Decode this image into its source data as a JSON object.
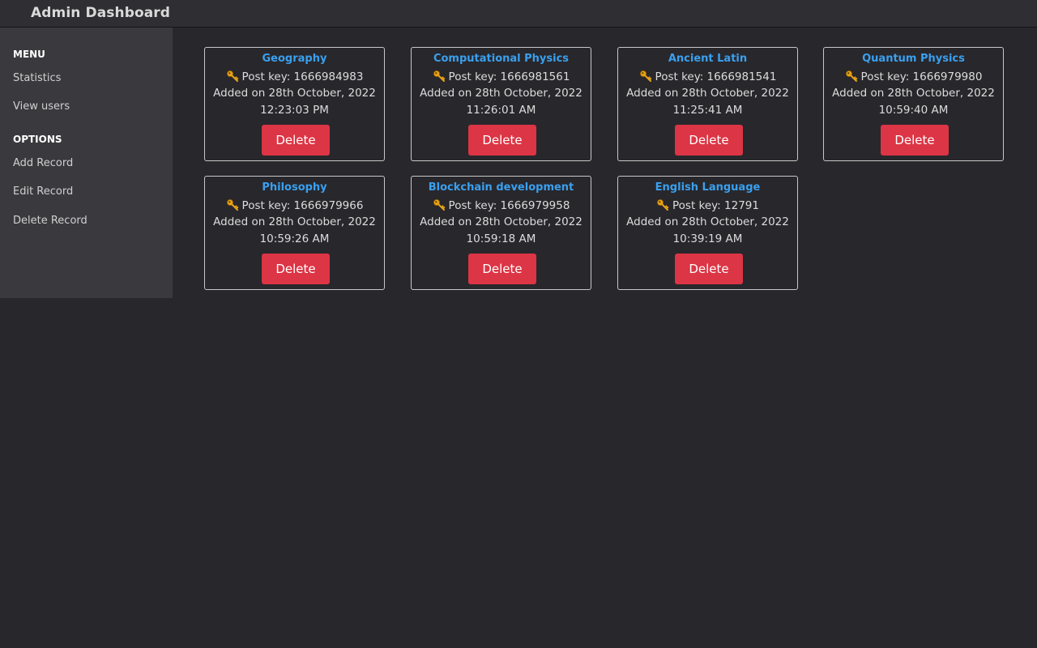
{
  "header": {
    "title": "Admin Dashboard"
  },
  "sidebar": {
    "sections": [
      {
        "title": "MENU",
        "items": [
          {
            "label": "Statistics"
          },
          {
            "label": "View users"
          }
        ]
      },
      {
        "title": "OPTIONS",
        "items": [
          {
            "label": "Add Record"
          },
          {
            "label": "Edit Record"
          },
          {
            "label": "Delete Record"
          }
        ]
      }
    ]
  },
  "records": [
    {
      "title": "Geography",
      "key_label": "Post key: 1666984983",
      "date_label": "Added on 28th October, 2022",
      "time_label": "12:23:03 PM",
      "delete_label": "Delete"
    },
    {
      "title": "Computational Physics",
      "key_label": "Post key: 1666981561",
      "date_label": "Added on 28th October, 2022",
      "time_label": "11:26:01 AM",
      "delete_label": "Delete"
    },
    {
      "title": "Ancient Latin",
      "key_label": "Post key: 1666981541",
      "date_label": "Added on 28th October, 2022",
      "time_label": "11:25:41 AM",
      "delete_label": "Delete"
    },
    {
      "title": "Quantum Physics",
      "key_label": "Post key: 1666979980",
      "date_label": "Added on 28th October, 2022",
      "time_label": "10:59:40 AM",
      "delete_label": "Delete"
    },
    {
      "title": "Philosophy",
      "key_label": "Post key: 1666979966",
      "date_label": "Added on 28th October, 2022",
      "time_label": "10:59:26 AM",
      "delete_label": "Delete"
    },
    {
      "title": "Blockchain development",
      "key_label": "Post key: 1666979958",
      "date_label": "Added on 28th October, 2022",
      "time_label": "10:59:18 AM",
      "delete_label": "Delete"
    },
    {
      "title": "English Language",
      "key_label": "Post key: 12791",
      "date_label": "Added on 28th October, 2022",
      "time_label": "10:39:19 AM",
      "delete_label": "Delete"
    }
  ],
  "icons": {
    "key": "key-icon"
  },
  "colors": {
    "title_link": "#3aa0ee",
    "delete_button": "#dc3545",
    "key_icon": "#e8a317",
    "background": "#28272c",
    "sidebar": "#3a393e"
  }
}
